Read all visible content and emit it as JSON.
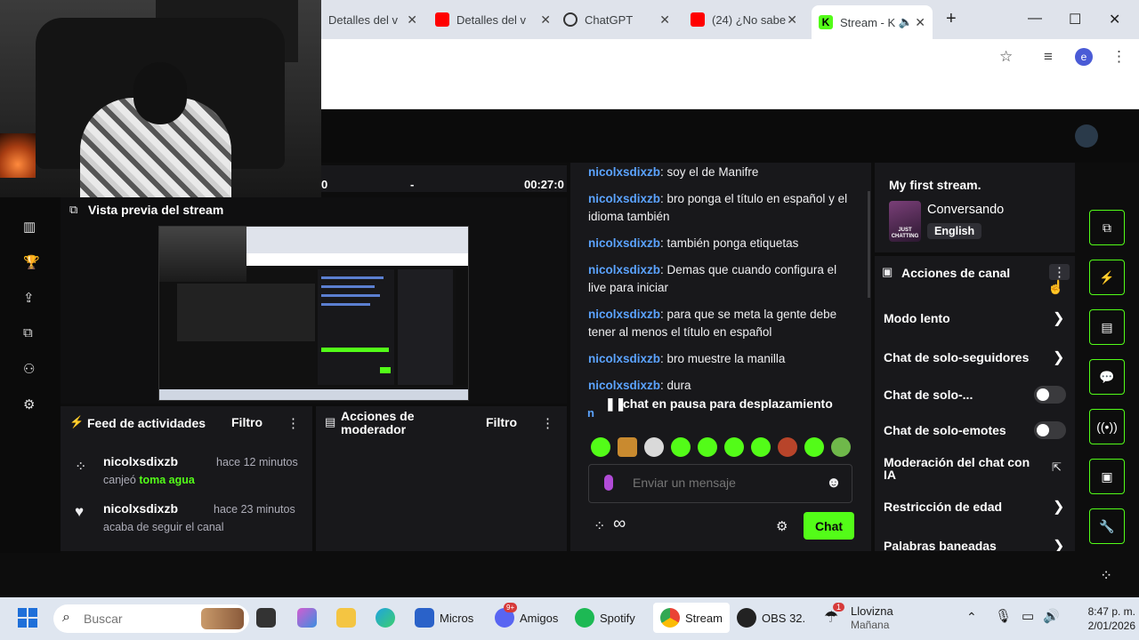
{
  "browser": {
    "tabs": [
      {
        "label": "Detalles del v",
        "icon": "studio-icon"
      },
      {
        "label": "Detalles del v",
        "icon": "youtube-icon"
      },
      {
        "label": "ChatGPT",
        "icon": "chatgpt-icon"
      },
      {
        "label": "(24) ¿No sabe",
        "icon": "youtube-icon"
      },
      {
        "label": "Stream - K",
        "icon": "kick-icon"
      }
    ],
    "colors": {
      "tabbar": "#dfe3eb",
      "youtube": "#ff0000",
      "kick": "#53fc18"
    },
    "profile_initial": "e"
  },
  "dashboard": {
    "timer": {
      "left": "0",
      "mid": "-",
      "right": "00:27:0"
    },
    "preview": {
      "title": "Vista previa del stream"
    },
    "activity_feed": {
      "title": "Feed de actividades",
      "filter_label": "Filtro",
      "items": [
        {
          "user": "nicolxsdixzb",
          "time": "hace 12 minutos",
          "action": "canjeó",
          "highlight": "toma agua"
        },
        {
          "user": "nicolxsdixzb",
          "time": "hace 23 minutos",
          "action": "acaba de seguir el canal",
          "highlight": ""
        }
      ]
    },
    "mod_actions": {
      "title_line1": "Acciones de",
      "title_line2": "moderador",
      "filter_label": "Filtro"
    },
    "chat": {
      "messages": [
        {
          "user": "nicolxsdixzb",
          "text": ": soy el de Manifre"
        },
        {
          "user": "nicolxsdixzb",
          "text": ": bro ponga el título en español y el idioma también"
        },
        {
          "user": "nicolxsdixzb",
          "text": ": también ponga etiquetas"
        },
        {
          "user": "nicolxsdixzb",
          "text": ": Demas que cuando configura el live para iniciar"
        },
        {
          "user": "nicolxsdixzb",
          "text": ": para que se meta la gente debe tener al menos el título en español"
        },
        {
          "user": "nicolxsdixzb",
          "text": ": bro muestre la manilla"
        },
        {
          "user": "nicolxsdixzb",
          "text": ": dura"
        }
      ],
      "fragment_letter": "n",
      "paused_label": "chat en pausa para desplazamiento",
      "input_placeholder": "Enviar un mensaje",
      "send_label": "Chat",
      "accent": "#53fc18",
      "username_color": "#5ba3ff"
    },
    "stream_info": {
      "title": "My first stream.",
      "category": "Conversando",
      "thumb_label": "JUST CHATTING",
      "language": "English"
    },
    "channel_actions": {
      "title": "Acciones de canal",
      "items": [
        {
          "label": "Modo lento",
          "control": "chevron"
        },
        {
          "label": "Chat de solo-seguidores",
          "control": "chevron"
        },
        {
          "label": "Chat de solo-...",
          "control": "toggle"
        },
        {
          "label": "Chat de solo-emotes",
          "control": "toggle"
        },
        {
          "label": "Moderación del chat con IA",
          "control": "external"
        },
        {
          "label": "Restricción de edad",
          "control": "chevron"
        },
        {
          "label": "Palabras baneadas",
          "control": "chevron"
        }
      ]
    }
  },
  "taskbar": {
    "search_placeholder": "Buscar",
    "apps": [
      {
        "label": "Micros"
      },
      {
        "label": "Amigos",
        "badge": "9+"
      },
      {
        "label": "Spotify"
      },
      {
        "label": "Stream"
      },
      {
        "label": "OBS 32."
      }
    ],
    "weather": {
      "title": "Llovizna",
      "subtitle": "Mañana",
      "badge": "1"
    },
    "clock": {
      "time": "8:47 p. m.",
      "date": "2/01/2026"
    }
  }
}
